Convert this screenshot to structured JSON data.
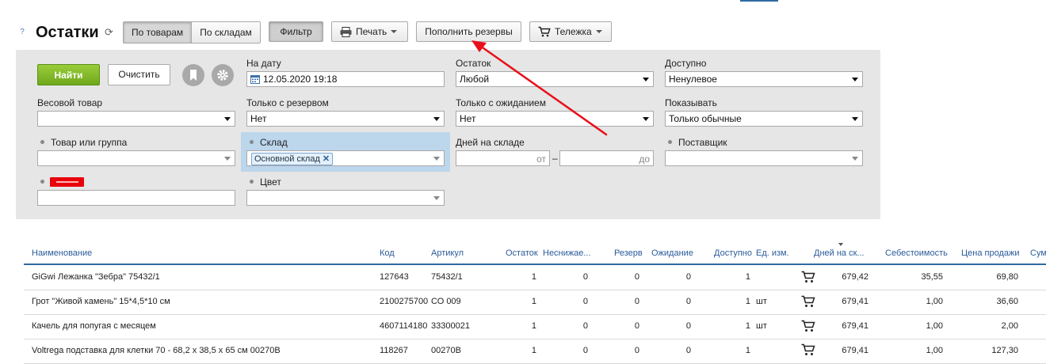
{
  "header": {
    "help": "?",
    "title": "Остатки",
    "view_toggle": [
      "По товарам",
      "По складам"
    ],
    "filter_label": "Фильтр",
    "print_label": "Печать",
    "reserve_label": "Пополнить резервы",
    "cart_label": "Тележка"
  },
  "filters": {
    "find_label": "Найти",
    "clear_label": "Очистить",
    "date": {
      "label": "На дату",
      "value": "12.05.2020 19:18"
    },
    "stock": {
      "label": "Остаток",
      "value": "Любой"
    },
    "available": {
      "label": "Доступно",
      "value": "Ненулевое"
    },
    "weight": {
      "label": "Весовой товар",
      "value": ""
    },
    "reserve": {
      "label": "Только с резервом",
      "value": "Нет"
    },
    "expect": {
      "label": "Только с ожиданием",
      "value": "Нет"
    },
    "show": {
      "label": "Показывать",
      "value": "Только обычные"
    },
    "product": {
      "label": "Товар или группа",
      "value": ""
    },
    "warehouse": {
      "label": "Склад",
      "tag": "Основной склад",
      "remove": "✕"
    },
    "days": {
      "label": "Дней на складе",
      "from": "от",
      "dash": "–",
      "to": "до"
    },
    "supplier": {
      "label": "Поставщик",
      "value": ""
    },
    "color": {
      "label": "Цвет",
      "value": ""
    }
  },
  "table": {
    "columns": [
      "Наименование",
      "Код",
      "Артикул",
      "Остаток",
      "Неснижае...",
      "Резерв",
      "Ожидание",
      "Доступно",
      "Ед. изм.",
      "Дней на ск...",
      "Себестоимость",
      "Цена продажи",
      "Сумм"
    ],
    "rows": [
      {
        "name": "GiGwi Лежанка \"Зебра\" 75432/1",
        "code": "127643",
        "article": "75432/1",
        "stock": "1",
        "min": "0",
        "reserve": "0",
        "expect": "0",
        "avail": "1",
        "unit": "",
        "days": "679,42",
        "cost": "35,55",
        "price": "69,80"
      },
      {
        "name": "Грот \"Живой камень\" 15*4,5*10 см",
        "code": "2100275700",
        "article": "СО 009",
        "stock": "1",
        "min": "0",
        "reserve": "0",
        "expect": "0",
        "avail": "1",
        "unit": "шт",
        "days": "679,41",
        "cost": "1,00",
        "price": "36,60"
      },
      {
        "name": "Качель для попугая с месяцем",
        "code": "4607114180",
        "article": "33300021",
        "stock": "1",
        "min": "0",
        "reserve": "0",
        "expect": "0",
        "avail": "1",
        "unit": "шт",
        "days": "679,41",
        "cost": "1,00",
        "price": "2,00"
      },
      {
        "name": "Voltrega подставка для клетки 70 - 68,2 х 38,5 х 65 см 00270В",
        "code": "118267",
        "article": "00270В",
        "stock": "1",
        "min": "0",
        "reserve": "0",
        "expect": "0",
        "avail": "1",
        "unit": "",
        "days": "679,41",
        "cost": "1,00",
        "price": "127,30"
      }
    ]
  },
  "colors": {
    "accent_blue": "#2f6aa3",
    "find_green": "#7cb526",
    "arrow_red": "#e8101a"
  }
}
